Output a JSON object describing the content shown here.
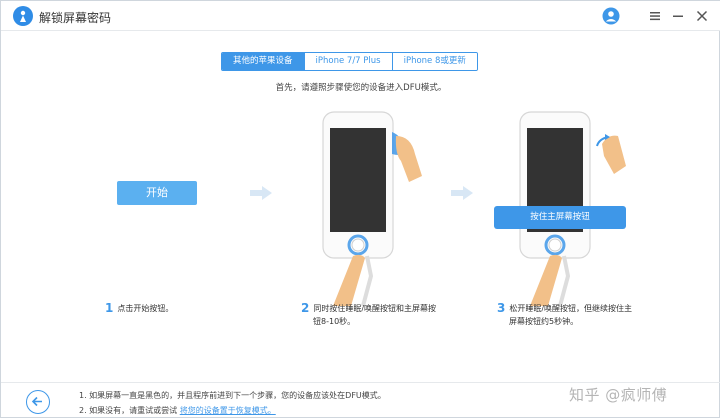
{
  "window": {
    "title": "解锁屏幕密码"
  },
  "tabs": [
    {
      "label": "其他的苹果设备",
      "active": true
    },
    {
      "label": "iPhone 7/7 Plus",
      "active": false
    },
    {
      "label": "iPhone 8或更新",
      "active": false
    }
  ],
  "instruction": "首先，请遵照步骤使您的设备进入DFU模式。",
  "start_button": "开始",
  "tooltip": "按住主屏幕按钮",
  "steps": [
    {
      "number": "1",
      "line1": "点击开始按钮。",
      "line2": ""
    },
    {
      "number": "2",
      "line1": "同时按住睡眠/唤醒按钮和主屏幕按",
      "line2": "钮8-10秒。"
    },
    {
      "number": "3",
      "line1": "松开睡眠/唤醒按钮，但继续按住主",
      "line2": "屏幕按钮约5秒钟。"
    }
  ],
  "footer": {
    "note1": "1. 如果屏幕一直是黑色的，并且程序前进到下一个步骤，您的设备应该处在DFU模式。",
    "note2_prefix": "2. 如果没有，请重试或尝试",
    "note2_link": "将您的设备置于恢复模式。"
  },
  "watermark": "知乎 @疯师傅",
  "colors": {
    "accent": "#3e97e8",
    "button": "#5bb0f0",
    "phone_screen": "#333333",
    "hand": "#f2c089"
  },
  "icons": [
    "app-logo-icon",
    "user-icon",
    "menu-icon",
    "minimize-icon",
    "close-icon",
    "arrow-right-icon",
    "back-arrow-icon"
  ]
}
